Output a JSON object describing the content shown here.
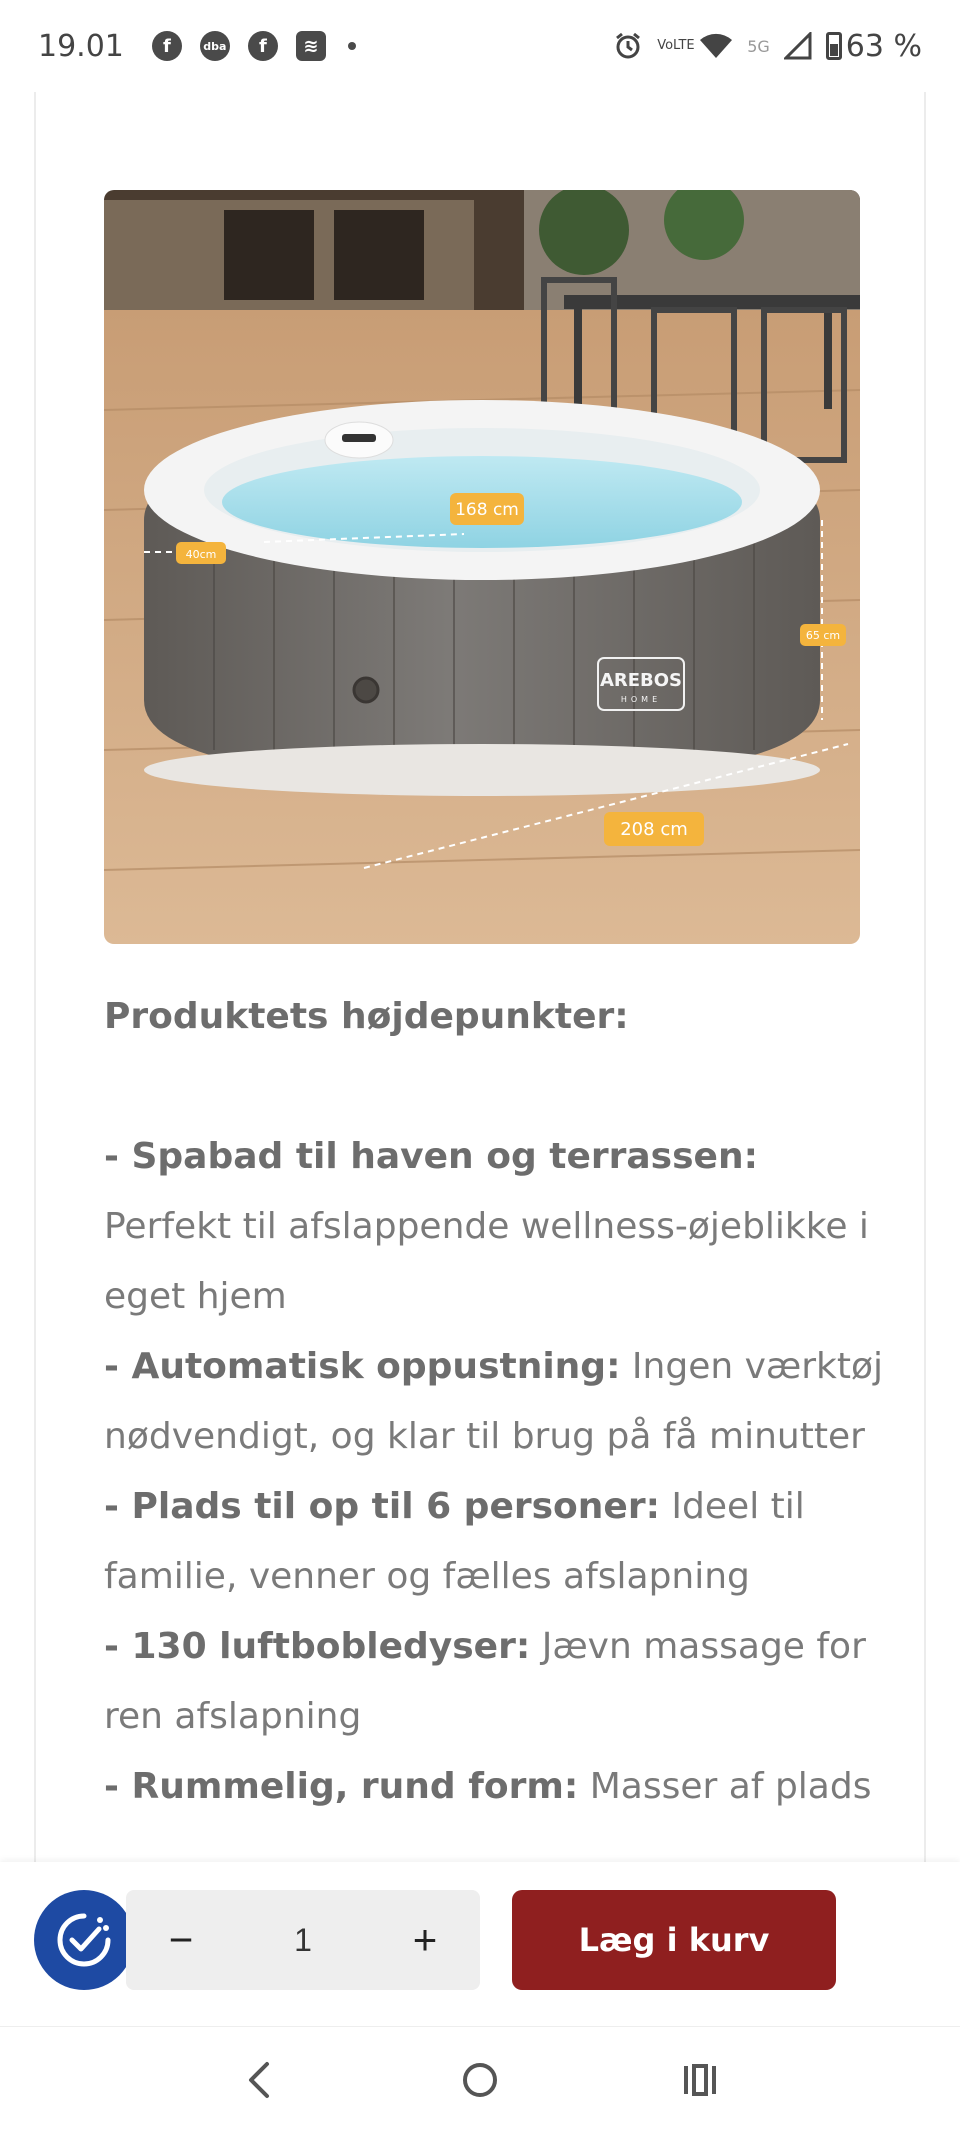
{
  "status_bar": {
    "time": "19.01",
    "left_icons": [
      "facebook-icon",
      "dba-chat-icon",
      "facebook-icon",
      "stack-app-icon",
      "notification-dot"
    ],
    "right_icons": [
      "alarm-icon",
      "volte-icon",
      "wifi-icon",
      "5g-icon",
      "signal-icon",
      "battery-icon"
    ],
    "volte_label": "VoLTE",
    "network_label": "5G",
    "battery": "63 %"
  },
  "product": {
    "image_labels": {
      "diameter_inner": "168 cm",
      "wall": "40cm",
      "height": "65 cm",
      "diameter_outer": "208 cm",
      "brand": "AREBOS",
      "brand_sub": "HOME"
    },
    "highlights_title": "Produktets højdepunkter:",
    "highlights": [
      {
        "bold": "- Spabad til haven og terrassen:",
        "text": " Perfekt til afslappende wellness-øjeblikke i eget hjem"
      },
      {
        "bold": "- Automatisk oppustning:",
        "text": " Ingen værktøj nødvendigt, og klar til brug på få minutter"
      },
      {
        "bold": "- Plads til op til 6 personer:",
        "text": " Ideel til familie, venner og fælles afslapning"
      },
      {
        "bold": "- 130 luftbobledyser:",
        "text": " Jævn massage for ren afslapning"
      },
      {
        "bold": "- Rummelig, rund form:",
        "text": " Masser af plads"
      }
    ]
  },
  "action_bar": {
    "quantity": "1",
    "minus": "−",
    "plus": "+",
    "add_to_cart": "Læg i kurv",
    "accent": "#8f1f1f"
  },
  "nav_bar": {
    "buttons": [
      "back-icon",
      "home-icon",
      "recents-icon"
    ]
  }
}
